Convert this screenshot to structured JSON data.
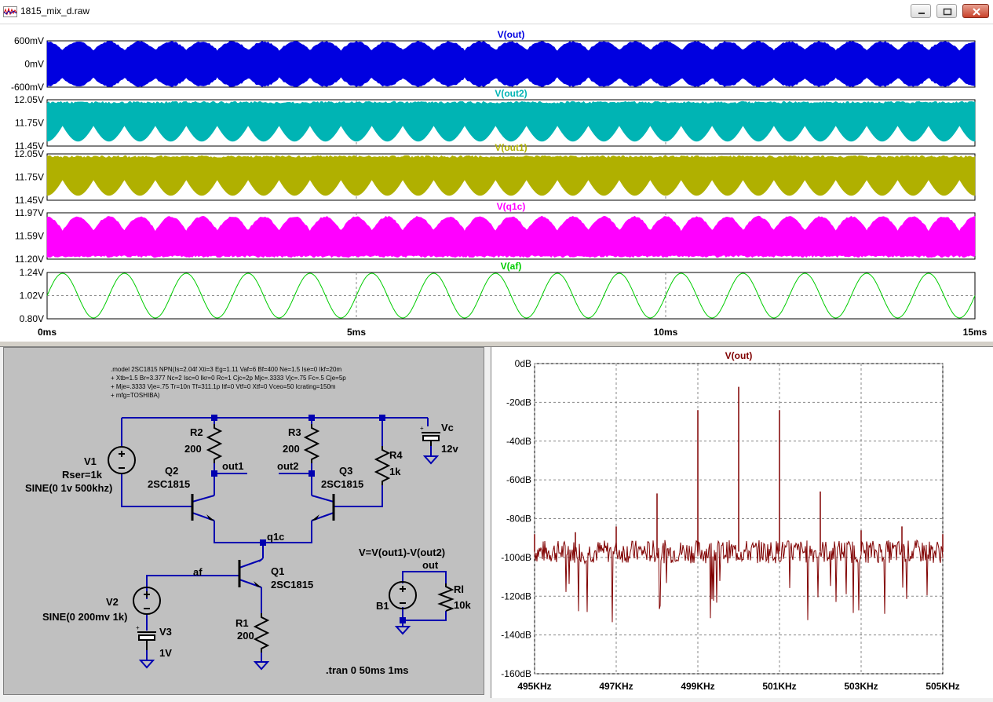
{
  "window": {
    "title": "1815_mix_d.raw"
  },
  "waveform_panes": [
    {
      "trace": "V(out)",
      "color": "#0000e0",
      "ticks": [
        "600mV",
        "0mV",
        "-600mV"
      ]
    },
    {
      "trace": "V(out2)",
      "color": "#00b4b4",
      "ticks": [
        "12.05V",
        "11.75V",
        "11.45V"
      ]
    },
    {
      "trace": "V(out1)",
      "color": "#b0b000",
      "ticks": [
        "12.05V",
        "11.75V",
        "11.45V"
      ]
    },
    {
      "trace": "V(q1c)",
      "color": "#ff00ff",
      "ticks": [
        "11.97V",
        "11.59V",
        "11.20V"
      ]
    },
    {
      "trace": "V(af)",
      "color": "#00cc00",
      "ticks": [
        "1.24V",
        "1.02V",
        "0.80V"
      ]
    }
  ],
  "time_axis": {
    "ticks": [
      "0ms",
      "5ms",
      "10ms",
      "15ms"
    ],
    "range_ms": [
      0,
      15
    ],
    "af_frequency_hz": 1000
  },
  "schematic": {
    "model_lines": [
      ".model 2SC1815 NPN(Is=2.04f Xti=3 Eg=1.11 Vaf=6 Bf=400 Ne=1.5 Ise=0 Ikf=20m",
      "+ Xtb=1.5 Br=3.377 Nc=2 Isc=0 Ikr=0 Rc=1 Cjc=2p Mjc=.3333 Vjc=.75 Fc=.5 Cje=5p",
      "+ Mje=.3333 Vje=.75 Tr=10n Tf=311.1p Itf=0 Vtf=0 Xtf=0 Vceo=50 Icrating=150m",
      "+ mfg=TOSHIBA)"
    ],
    "labels": {
      "r2_name": "R2",
      "r2_value": "200",
      "r3_name": "R3",
      "r3_value": "200",
      "r4_name": "R4",
      "r4_value": "1k",
      "r1_name": "R1",
      "r1_value": "200",
      "rl_name": "Rl",
      "rl_value": "10k",
      "q1_name": "Q1",
      "q1_model": "2SC1815",
      "q2_name": "Q2",
      "q2_model": "2SC1815",
      "q3_name": "Q3",
      "q3_model": "2SC1815",
      "v1_name": "V1",
      "v1_rser": "Rser=1k",
      "v1_value": "SINE(0 1v 500khz)",
      "v2_name": "V2",
      "v2_value": "SINE(0 200mv 1k)",
      "v3_name": "V3",
      "v3_value": "1V",
      "vc_name": "Vc",
      "vc_value": "12v",
      "b1_name": "B1",
      "b1_expr": "V=V(out1)-V(out2)",
      "net_out1": "out1",
      "net_out2": "out2",
      "net_q1c": "q1c",
      "net_af": "af",
      "net_out": "out",
      "tran": ".tran 0 50ms 1ms"
    }
  },
  "fft": {
    "title": "V(out)",
    "trace_color": "#800000",
    "y_ticks": [
      "0dB",
      "-20dB",
      "-40dB",
      "-60dB",
      "-80dB",
      "-100dB",
      "-120dB",
      "-140dB",
      "-160dB"
    ],
    "x_ticks": [
      "495KHz",
      "497KHz",
      "499KHz",
      "501KHz",
      "503KHz",
      "505KHz"
    ],
    "chart_data": {
      "type": "line",
      "xlabel": "",
      "ylabel": "",
      "xlim_khz": [
        495,
        505
      ],
      "ylim_db": [
        -160,
        0
      ],
      "x_khz": [
        495,
        496,
        497,
        498,
        499,
        500,
        501,
        502,
        503,
        504,
        505
      ],
      "peaks_db": [
        -88,
        -87,
        -84,
        -67,
        -24,
        -12,
        -24,
        -66,
        -86,
        -84,
        -88
      ],
      "noise_floor_db": -97
    }
  }
}
